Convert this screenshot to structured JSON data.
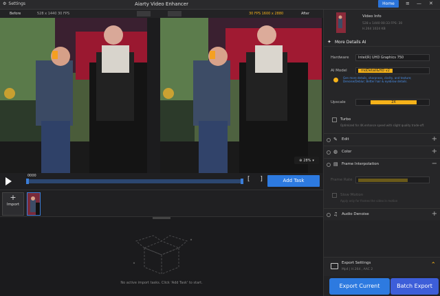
{
  "titlebar": {
    "settings_label": "Settings",
    "app_title": "Aiarty Video Enhancer",
    "home_label": "Home"
  },
  "video_header": {
    "before_label": "Before",
    "before_info": "528 x 1440   30 FPS",
    "after_info": "30 FPS   1600 x 2880",
    "after_label": "After"
  },
  "preview": {
    "zoom_value": "28%"
  },
  "playback": {
    "time": "0000"
  },
  "toolbar": {
    "add_task_label": "Add Task"
  },
  "tasks": {
    "import_label": "Import",
    "empty_text": "No active import tasks. Click 'Add Task' to start."
  },
  "panel": {
    "video_info": {
      "title": "Video Info",
      "line1": "528 x 1440  00:33    FPS: 30",
      "line2": "H.264   1024 KB"
    },
    "more_details_title": "More Details AI",
    "hardware_label": "Hardware",
    "hardware_value": "Intel(R) UHD Graphics 750",
    "ai_model_label": "AI Model",
    "ai_model_value": "moDetail&HD v2",
    "ai_model_desc": "Gen more details, sharpness, clarity, and texture; Denoise/Deblur; Better hair & eyebrow details.",
    "upscale_label": "Upscale",
    "upscale_value": "2X",
    "turbo_label": "Turbo",
    "turbo_desc": "Optimized for 4K.enhance speed with slight quality trade-off.",
    "edit_label": "Edit",
    "color_label": "Color",
    "frame_interp_label": "Frame Interpolation",
    "frame_rate_label": "Frame Rate",
    "slow_motion_label": "Slow Motion",
    "slow_motion_desc": "Apply only for frames the video in motion",
    "audio_denoise_label": "Audio Denoise",
    "export_settings_title": "Export Settings",
    "export_settings_desc": "Mp4 | H.264 , AAC 2",
    "export_current_label": "Export Current",
    "batch_export_label": "Batch Export"
  },
  "colors": {
    "accent": "#2d7ae0",
    "highlight": "#f5b21a"
  }
}
